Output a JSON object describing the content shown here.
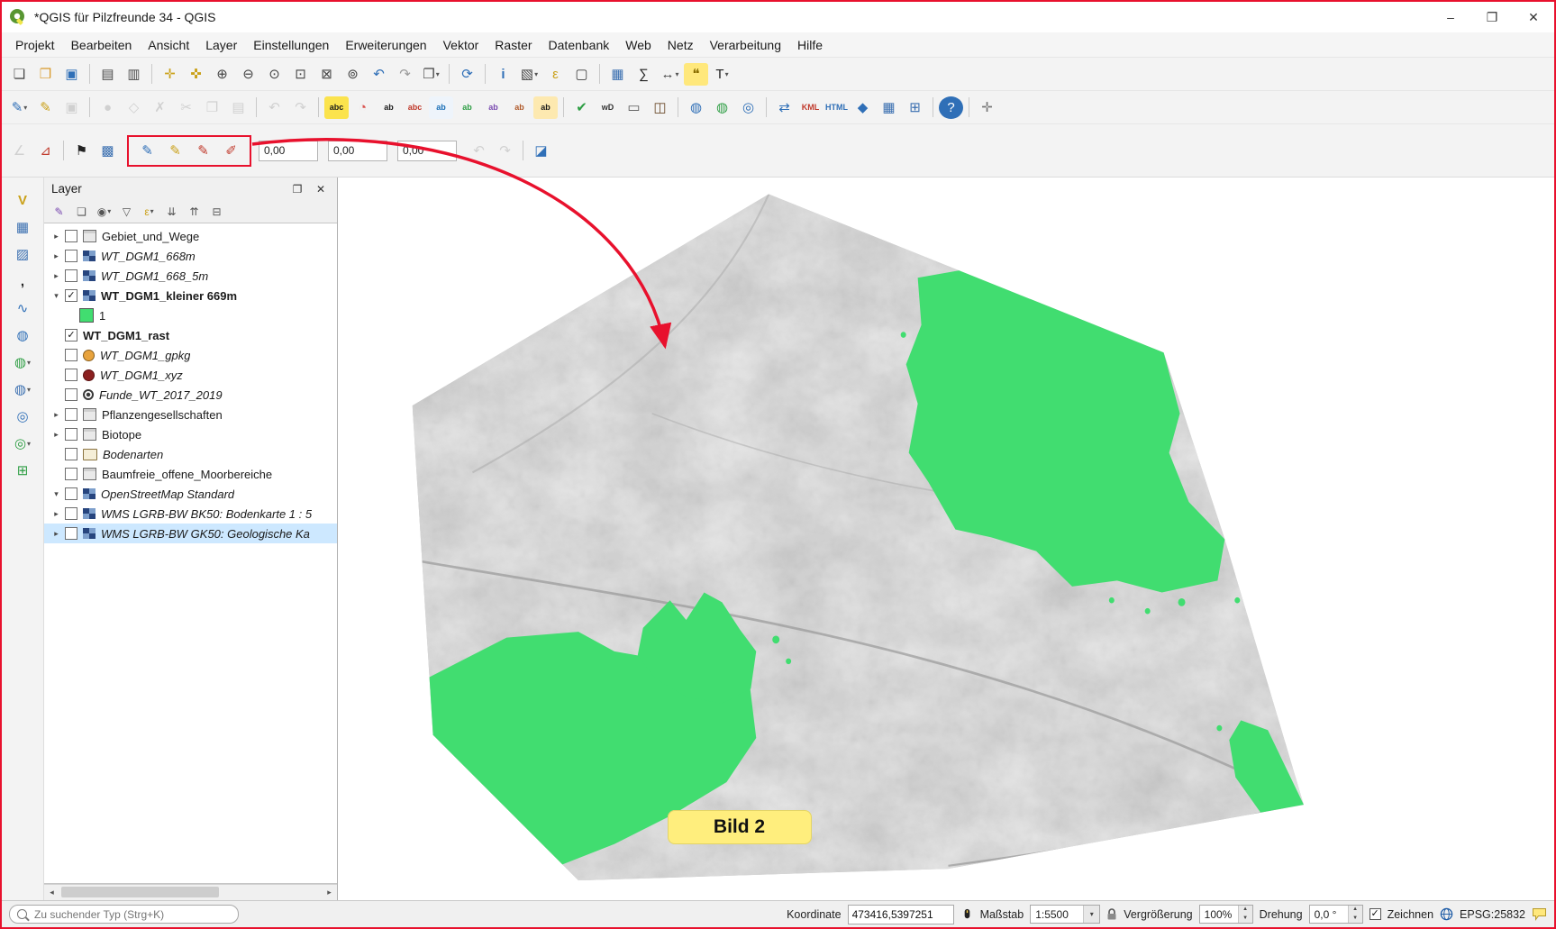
{
  "window": {
    "title": "*QGIS für Pilzfreunde 34 - QGIS",
    "controls": {
      "minimize": "–",
      "maximize": "❐",
      "close": "✕"
    }
  },
  "menubar": [
    "Projekt",
    "Bearbeiten",
    "Ansicht",
    "Layer",
    "Einstellungen",
    "Erweiterungen",
    "Vektor",
    "Raster",
    "Datenbank",
    "Web",
    "Netz",
    "Verarbeitung",
    "Hilfe"
  ],
  "toolbars": {
    "row1": [
      {
        "n": "new-project",
        "g": "❏",
        "c": "#4a4a4a"
      },
      {
        "n": "open-project",
        "g": "❒",
        "c": "#d99a2b"
      },
      {
        "n": "save-project",
        "g": "▣",
        "c": "#2f6fb7"
      },
      {
        "sep": true
      },
      {
        "n": "new-print-layout",
        "g": "▤",
        "c": "#4a4a4a"
      },
      {
        "n": "layout-manager",
        "g": "▥",
        "c": "#4a4a4a"
      },
      {
        "sep": true
      },
      {
        "n": "pan-map",
        "g": "✛",
        "c": "#caa11a"
      },
      {
        "n": "pan-to-selection",
        "g": "✜",
        "c": "#caa11a"
      },
      {
        "n": "zoom-in",
        "g": "⊕",
        "c": "#444444"
      },
      {
        "n": "zoom-out",
        "g": "⊖",
        "c": "#444444"
      },
      {
        "n": "zoom-native",
        "g": "⊙",
        "c": "#444444"
      },
      {
        "n": "zoom-full",
        "g": "⊡",
        "c": "#444444"
      },
      {
        "n": "zoom-to-selection",
        "g": "⊠",
        "c": "#444444"
      },
      {
        "n": "zoom-to-layer",
        "g": "⊚",
        "c": "#444444"
      },
      {
        "n": "zoom-last",
        "g": "↶",
        "c": "#2f6fb7"
      },
      {
        "n": "zoom-next",
        "g": "↷",
        "c": "#9a9a9a"
      },
      {
        "n": "new-map-view",
        "g": "❐",
        "c": "#444444",
        "dd": true
      },
      {
        "sep": true
      },
      {
        "n": "refresh-map",
        "g": "⟳",
        "c": "#2f6fb7"
      },
      {
        "sep": true
      },
      {
        "n": "identify-features",
        "g": "i",
        "c": "#2f6fb7",
        "bold": true
      },
      {
        "n": "select-features",
        "g": "▧",
        "c": "#444444",
        "dd": true
      },
      {
        "n": "select-by-expression",
        "g": "ε",
        "c": "#caa11a"
      },
      {
        "n": "deselect-features",
        "g": "▢",
        "c": "#444444"
      },
      {
        "sep": true
      },
      {
        "n": "open-attribute-table",
        "g": "▦",
        "c": "#3a6fb0"
      },
      {
        "n": "statistical-summary",
        "g": "∑",
        "c": "#222222"
      },
      {
        "n": "measure-line",
        "g": "↔",
        "c": "#444444",
        "dd": true
      },
      {
        "n": "map-tips",
        "g": "❝",
        "c": "#8a6d00",
        "bg": "#ffe87c"
      },
      {
        "n": "text-annotation",
        "g": "T",
        "c": "#222222",
        "dd": true
      }
    ],
    "row2": [
      {
        "n": "current-edits",
        "g": "✎",
        "c": "#2f6fb7",
        "dd": true
      },
      {
        "n": "toggle-editing",
        "g": "✎",
        "c": "#caa11a"
      },
      {
        "n": "save-layer-edits",
        "g": "▣",
        "c": "#9a9a9a",
        "d": true
      },
      {
        "sep": true
      },
      {
        "n": "add-feature",
        "g": "●",
        "c": "#9a9a9a",
        "d": true
      },
      {
        "n": "vertex-tool",
        "g": "◇",
        "c": "#9a9a9a",
        "d": true
      },
      {
        "n": "delete-selected",
        "g": "✗",
        "c": "#9a9a9a",
        "d": true
      },
      {
        "n": "cut-features",
        "g": "✂",
        "c": "#9a9a9a",
        "d": true
      },
      {
        "n": "copy-features",
        "g": "❐",
        "c": "#9a9a9a",
        "d": true
      },
      {
        "n": "paste-features",
        "g": "▤",
        "c": "#9a9a9a",
        "d": true
      },
      {
        "sep": true
      },
      {
        "n": "undo-edits",
        "g": "↶",
        "c": "#9a9a9a",
        "d": true
      },
      {
        "n": "redo-edits",
        "g": "↷",
        "c": "#9a9a9a",
        "d": true
      },
      {
        "sep": true
      },
      {
        "n": "layer-labeling-options",
        "g": "abc",
        "small": true,
        "c": "#1a1a1a",
        "bg": "#fbe34d"
      },
      {
        "n": "layer-diagram-options",
        "g": "◔",
        "c": "#d9534f"
      },
      {
        "n": "highlight-unplaced-labels",
        "g": "ab",
        "small": true,
        "c": "#1a1a1a"
      },
      {
        "n": "toggle-unplaced-labels",
        "g": "abc",
        "small": true,
        "c": "#c0392b"
      },
      {
        "n": "pin-labels",
        "g": "ab",
        "small": true,
        "c": "#1a6fb7",
        "bg": "#eef4fb"
      },
      {
        "n": "show-hide-labels",
        "g": "ab",
        "small": true,
        "c": "#2e9e44"
      },
      {
        "n": "move-label",
        "g": "ab",
        "small": true,
        "c": "#7a4bb0"
      },
      {
        "n": "rotate-label",
        "g": "ab",
        "small": true,
        "c": "#b05a2a"
      },
      {
        "n": "change-label-properties",
        "g": "ab",
        "small": true,
        "c": "#1a1a1a",
        "bg": "#fde9b0"
      },
      {
        "sep": true
      },
      {
        "n": "check-geometries",
        "g": "✔",
        "c": "#2e9e44"
      },
      {
        "n": "wd-plugin",
        "g": "wD",
        "small": true,
        "c": "#333333"
      },
      {
        "n": "offline-editing",
        "g": "▭",
        "c": "#555555"
      },
      {
        "n": "db-manager",
        "g": "◫",
        "c": "#6b4a2a"
      },
      {
        "sep": true
      },
      {
        "n": "metasearch-catalog",
        "g": "◍",
        "c": "#2f6fb7"
      },
      {
        "n": "web-map-services",
        "g": "◍",
        "c": "#2e9e44"
      },
      {
        "n": "search-geodata",
        "g": "◎",
        "c": "#2f6fb7"
      },
      {
        "sep": true
      },
      {
        "n": "layer-converter",
        "g": "⇄",
        "c": "#2f6fb7"
      },
      {
        "n": "kml-tools",
        "g": "KML",
        "small": true,
        "c": "#c0392b"
      },
      {
        "n": "html-tools",
        "g": "HTML",
        "small": true,
        "c": "#2f6fb7"
      },
      {
        "n": "qgis2threejs",
        "g": "◆",
        "c": "#2f6fb7"
      },
      {
        "n": "raster-tools",
        "g": "▦",
        "c": "#3a6fb0"
      },
      {
        "n": "data-grid-tools",
        "g": "⊞",
        "c": "#3a6fb0"
      },
      {
        "sep": true
      },
      {
        "n": "help",
        "g": "?",
        "c": "#ffffff",
        "bg": "#2f6fb7",
        "round": true
      },
      {
        "sep": true
      },
      {
        "n": "crosshair",
        "g": "✛",
        "c": "#777777"
      }
    ],
    "row3_pre": [
      {
        "n": "advanced-digitizing-panel",
        "g": "∠",
        "c": "#9a9a9a",
        "d": true
      },
      {
        "n": "snapping-options",
        "g": "⊿",
        "c": "#c0392b"
      },
      {
        "sep": true
      },
      {
        "n": "plot-point-tool",
        "g": "⚑",
        "c": "#222222"
      },
      {
        "n": "raster-value-tool",
        "g": "▩",
        "c": "#3a6fb0"
      }
    ],
    "row3_highlight": [
      {
        "n": "pixel-probe-tool",
        "g": "✎",
        "c": "#2f6fb7"
      },
      {
        "n": "pixel-draw-tool",
        "g": "✎",
        "c": "#caa11a"
      },
      {
        "n": "pixel-erase-tool",
        "g": "✎",
        "c": "#c0392b"
      },
      {
        "n": "pixel-erase-selection-tool",
        "g": "✐",
        "c": "#c0392b"
      }
    ],
    "row3_values": [
      "0,00",
      "0,00",
      "0,00"
    ],
    "row3_post": [
      {
        "n": "undo-raster-edit",
        "g": "↶",
        "c": "#9a9a9a",
        "d": true
      },
      {
        "n": "redo-raster-edit",
        "g": "↷",
        "c": "#9a9a9a",
        "d": true
      },
      {
        "sep": true
      },
      {
        "n": "raster-image-tool",
        "g": "◪",
        "c": "#2f6fb7"
      }
    ],
    "left": [
      {
        "n": "add-vector-layer",
        "g": "V",
        "c": "#caa11a",
        "bold": true
      },
      {
        "n": "add-raster-layer",
        "g": "▦",
        "c": "#3a6fb0"
      },
      {
        "n": "add-mesh-layer",
        "g": "▨",
        "c": "#3a6fb0"
      },
      {
        "n": "add-delimited-text-layer",
        "g": ",",
        "c": "#222222",
        "bold": true
      },
      {
        "n": "add-spatialite-layer",
        "g": "∿",
        "c": "#2f6fb7"
      },
      {
        "n": "add-postgis-layer",
        "g": "◍",
        "c": "#2f6fb7"
      },
      {
        "n": "add-wms-layer",
        "g": "◍",
        "c": "#2e9e44",
        "dd": true
      },
      {
        "n": "add-xyz-layer",
        "g": "◍",
        "c": "#3a6fb0",
        "dd": true
      },
      {
        "n": "add-wfs-layer",
        "g": "◎",
        "c": "#2f6fb7"
      },
      {
        "n": "add-arcgis-layer",
        "g": "◎",
        "c": "#2e9e44",
        "dd": true
      },
      {
        "n": "new-geopackage-layer",
        "g": "⊞",
        "c": "#2e9e44"
      }
    ]
  },
  "layer_panel": {
    "title": "Layer",
    "toolbar": [
      {
        "n": "open-layer-styling",
        "g": "✎",
        "c": "#7a4bb0"
      },
      {
        "n": "add-group",
        "g": "❏",
        "c": "#555555"
      },
      {
        "n": "manage-map-themes",
        "g": "◉",
        "c": "#555555",
        "dd": true
      },
      {
        "n": "filter-legend",
        "g": "▽",
        "c": "#555555"
      },
      {
        "n": "filter-by-expression",
        "g": "ε",
        "c": "#caa11a",
        "dd": true
      },
      {
        "n": "expand-all",
        "g": "⇊",
        "c": "#555555"
      },
      {
        "n": "collapse-all",
        "g": "⇈",
        "c": "#555555"
      },
      {
        "n": "remove-layer",
        "g": "⊟",
        "c": "#555555"
      }
    ],
    "layers": [
      {
        "name": "Gebiet_und_Wege",
        "arrow": "collapsed",
        "checked": false,
        "icon": "box",
        "style": "normal"
      },
      {
        "name": "WT_DGM1_668m",
        "arrow": "collapsed",
        "checked": false,
        "icon": "raster",
        "style": "italic"
      },
      {
        "name": "WT_DGM1_668_5m",
        "arrow": "collapsed",
        "checked": false,
        "icon": "raster",
        "style": "italic"
      },
      {
        "name": "WT_DGM1_kleiner 669m",
        "arrow": "expanded",
        "checked": true,
        "icon": "raster",
        "style": "bold"
      },
      {
        "name": "1",
        "child": true,
        "icon": "swatch-green",
        "style": "normal"
      },
      {
        "name": "WT_DGM1_rast",
        "checked": true,
        "icon": "none",
        "style": "bold"
      },
      {
        "name": "WT_DGM1_gpkg",
        "checked": false,
        "icon": "point-orange",
        "style": "italic"
      },
      {
        "name": "WT_DGM1_xyz",
        "checked": false,
        "icon": "point-darkred",
        "style": "italic"
      },
      {
        "name": "Funde_WT_2017_2019",
        "checked": false,
        "icon": "point-circle",
        "style": "italic"
      },
      {
        "name": "Pflanzengesellschaften",
        "arrow": "collapsed",
        "checked": false,
        "icon": "box",
        "style": "normal"
      },
      {
        "name": "Biotope",
        "arrow": "collapsed",
        "checked": false,
        "icon": "box",
        "style": "normal"
      },
      {
        "name": "Bodenarten",
        "checked": false,
        "icon": "folder",
        "style": "italic"
      },
      {
        "name": "Baumfreie_offene_Moorbereiche",
        "checked": false,
        "icon": "box",
        "style": "normal"
      },
      {
        "name": "OpenStreetMap Standard",
        "arrow": "expanded",
        "checked": false,
        "icon": "raster",
        "style": "italic"
      },
      {
        "name": "WMS LGRB-BW BK50: Bodenkarte 1 : 5",
        "arrow": "collapsed",
        "checked": false,
        "icon": "raster",
        "style": "italic"
      },
      {
        "name": "WMS LGRB-BW GK50: Geologische Ka",
        "arrow": "collapsed",
        "checked": false,
        "icon": "raster",
        "style": "italic",
        "selected": true
      }
    ]
  },
  "map": {
    "annotation_label": "Bild 2",
    "terrain_color": "#bcbcbc",
    "patch_color": "#41dd70"
  },
  "statusbar": {
    "search_placeholder": "Zu suchender Typ (Strg+K)",
    "coordinate_label": "Koordinate",
    "coordinate_value": "473416,5397251",
    "scale_label": "Maßstab",
    "scale_value": "1:5500",
    "magnifier_label": "Vergrößerung",
    "magnifier_value": "100%",
    "rotation_label": "Drehung",
    "rotation_value": "0,0 °",
    "render_label": "Zeichnen",
    "crs_label": "EPSG:25832"
  }
}
